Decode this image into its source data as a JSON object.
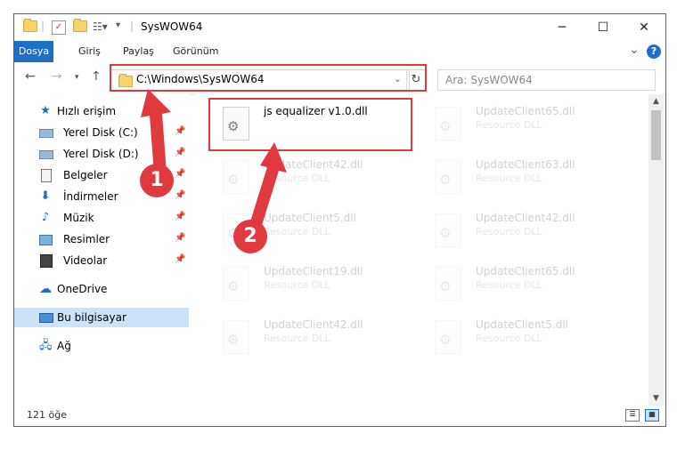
{
  "window": {
    "title": "SysWOW64",
    "controls": {
      "minimize": "─",
      "maximize": "☐",
      "close": "✕"
    }
  },
  "ribbon": {
    "tabs": [
      "Dosya",
      "Giriş",
      "Paylaş",
      "Görünüm"
    ],
    "expand_icon": "⌄",
    "help_icon": "?"
  },
  "address": {
    "path": "C:\\Windows\\SysWOW64",
    "search_placeholder": "Ara: SysWOW64"
  },
  "sidebar": {
    "quick_access": "Hızlı erişim",
    "items": [
      {
        "label": "Yerel Disk (C:)",
        "icon": "drive-icon"
      },
      {
        "label": "Yerel Disk (D:)",
        "icon": "drive-icon"
      },
      {
        "label": "Belgeler",
        "icon": "documents-icon"
      },
      {
        "label": "İndirmeler",
        "icon": "downloads-icon"
      },
      {
        "label": "Müzik",
        "icon": "music-icon"
      },
      {
        "label": "Resimler",
        "icon": "pictures-icon"
      },
      {
        "label": "Videolar",
        "icon": "videos-icon"
      }
    ],
    "onedrive": "OneDrive",
    "this_pc": "Bu bilgisayar",
    "network": "Ağ"
  },
  "files": [
    {
      "name": "js equalizer v1.0.dll",
      "type": ""
    },
    {
      "name": "UpdateClient65.dll",
      "type": "Resource DLL"
    },
    {
      "name": "UpdateClient42.dll",
      "type": "Resource DLL"
    },
    {
      "name": "UpdateClient63.dll",
      "type": "Resource DLL"
    },
    {
      "name": "UpdateClient5.dll",
      "type": "Resource DLL"
    },
    {
      "name": "UpdateClient42.dll",
      "type": "Resource DLL"
    },
    {
      "name": "UpdateClient19.dll",
      "type": "Resource DLL"
    },
    {
      "name": "UpdateClient65.dll",
      "type": "Resource DLL"
    },
    {
      "name": "UpdateClient42.dll",
      "type": "Resource DLL"
    },
    {
      "name": "UpdateClient5.dll",
      "type": "Resource DLL"
    }
  ],
  "status": {
    "count": "121 öğe"
  },
  "annotations": {
    "step1": "1",
    "step2": "2"
  },
  "colors": {
    "accent": "#1e6fc7",
    "annotation": "#e0393e"
  }
}
